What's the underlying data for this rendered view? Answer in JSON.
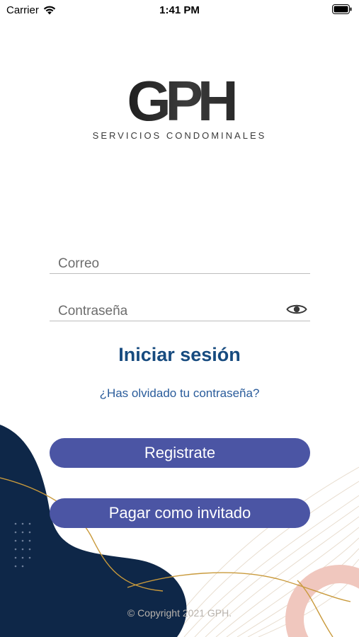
{
  "status_bar": {
    "carrier": "Carrier",
    "time": "1:41 PM",
    "icons": [
      "wifi-icon",
      "battery-icon"
    ]
  },
  "logo": {
    "mark": "GPH",
    "subtitle": "SERVICIOS CONDOMINALES"
  },
  "form": {
    "email_placeholder": "Correo",
    "password_placeholder": "Contraseña",
    "password_toggle_icon": "eye-icon",
    "login_label": "Iniciar sesión",
    "forgot_label": "¿Has olvidado tu contraseña?"
  },
  "actions": {
    "register_label": "Registrate",
    "guest_label": "Pagar como invitado"
  },
  "footer": {
    "copyright": "© Copyright 2021 GPH."
  },
  "colors": {
    "primary_button": "#4b55a4",
    "login_text": "#174b7f",
    "link": "#2a5c9b",
    "navy_decor": "#0e2748",
    "gold_line": "#c99a3c",
    "pink_decor": "#f0c7be"
  }
}
